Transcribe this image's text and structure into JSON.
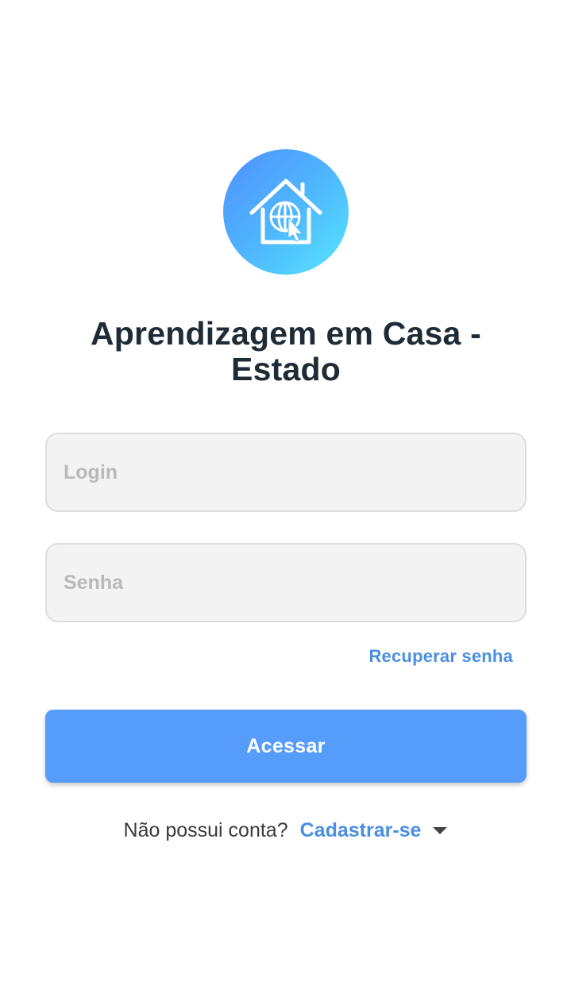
{
  "app": {
    "logo_icon": "house-globe-cursor-icon",
    "title": "Aprendizagem em Casa - Estado"
  },
  "form": {
    "login_placeholder": "Login",
    "password_placeholder": "Senha",
    "recover_label": "Recuperar senha",
    "submit_label": "Acessar"
  },
  "signup": {
    "question": "Não possui conta?",
    "link_label": "Cadastrar-se",
    "dropdown_icon": "caret-down-icon"
  },
  "colors": {
    "primary": "#559cfb",
    "link": "#4b8fe3",
    "title_text": "#1f2b35",
    "logo_gradient_start": "#4f90ff",
    "logo_gradient_end": "#56e6ff",
    "field_background": "#f3f3f3"
  }
}
